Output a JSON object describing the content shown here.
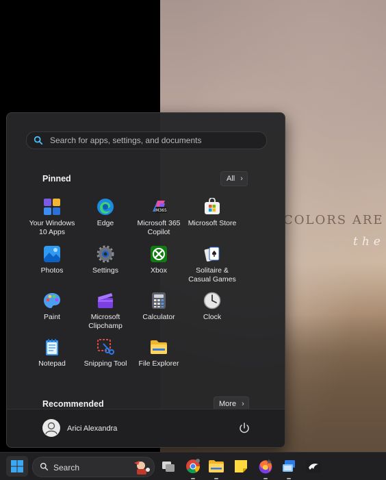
{
  "wallpaper": {
    "line1": "COLORS ARE",
    "line2": "the"
  },
  "start_menu": {
    "search_placeholder": "Search for apps, settings, and documents",
    "pinned_title": "Pinned",
    "all_label": "All",
    "pinned_apps": [
      {
        "name": "Your Windows 10 Apps",
        "icon": "windows-apps-folder-icon"
      },
      {
        "name": "Edge",
        "icon": "edge-icon"
      },
      {
        "name": "Microsoft 365 Copilot",
        "icon": "m365-copilot-icon"
      },
      {
        "name": "Microsoft Store",
        "icon": "store-icon"
      },
      {
        "name": "Photos",
        "icon": "photos-icon"
      },
      {
        "name": "Settings",
        "icon": "gear-icon"
      },
      {
        "name": "Xbox",
        "icon": "xbox-icon"
      },
      {
        "name": "Solitaire & Casual Games",
        "icon": "solitaire-icon"
      },
      {
        "name": "Paint",
        "icon": "paint-icon"
      },
      {
        "name": "Microsoft Clipchamp",
        "icon": "clipchamp-icon"
      },
      {
        "name": "Calculator",
        "icon": "calculator-icon"
      },
      {
        "name": "Clock",
        "icon": "clock-icon"
      },
      {
        "name": "Notepad",
        "icon": "notepad-icon"
      },
      {
        "name": "Snipping Tool",
        "icon": "snipping-tool-icon"
      },
      {
        "name": "File Explorer",
        "icon": "folder-icon"
      }
    ],
    "recommended_title": "Recommended",
    "more_label": "More",
    "user_name": "Arici Alexandra"
  },
  "taskbar": {
    "search_label": "Search",
    "apps": [
      "task-view-icon",
      "chrome-icon",
      "file-explorer-icon",
      "sticky-notes-icon",
      "firefox-icon",
      "remote-desktop-icon",
      "bird-app-icon"
    ]
  },
  "colors": {
    "menu_bg": "#262628",
    "taskbar_bg": "#202022",
    "accent": "#4cc2ff"
  }
}
